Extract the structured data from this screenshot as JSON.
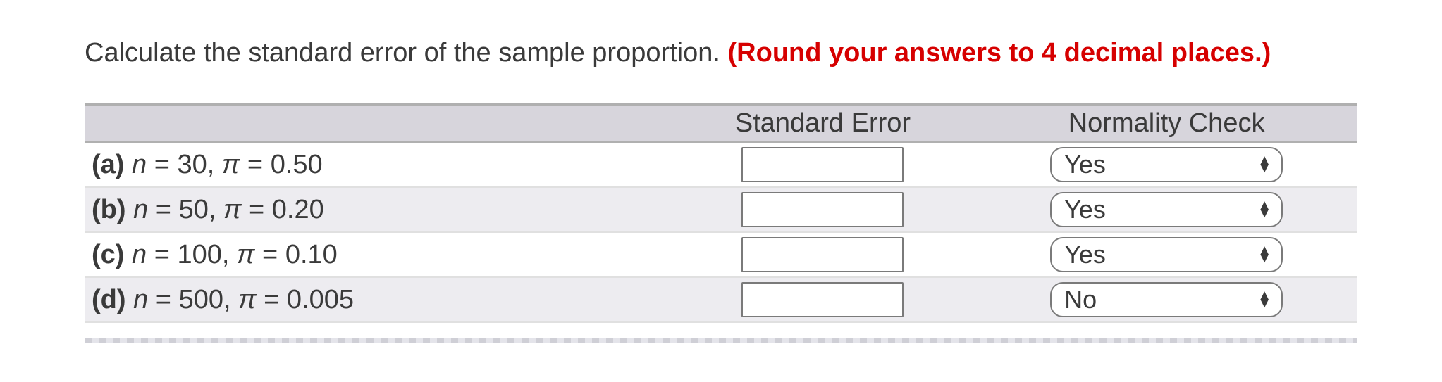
{
  "prompt": {
    "text": "Calculate the standard error of the sample proportion. ",
    "hint": "(Round your answers to 4 decimal places.)"
  },
  "headers": {
    "col_label": "",
    "col_se": "Standard Error",
    "col_nc": "Normality Check"
  },
  "rows": [
    {
      "tag": "(a)",
      "n": "30",
      "pi": "0.50",
      "se_value": "",
      "normality": "Yes"
    },
    {
      "tag": "(b)",
      "n": "50",
      "pi": "0.20",
      "se_value": "",
      "normality": "Yes"
    },
    {
      "tag": "(c)",
      "n": "100",
      "pi": "0.10",
      "se_value": "",
      "normality": "Yes"
    },
    {
      "tag": "(d)",
      "n": "500",
      "pi": "0.005",
      "se_value": "",
      "normality": "No"
    }
  ],
  "symbols": {
    "n": "n",
    "pi": "π",
    "eq": "="
  }
}
